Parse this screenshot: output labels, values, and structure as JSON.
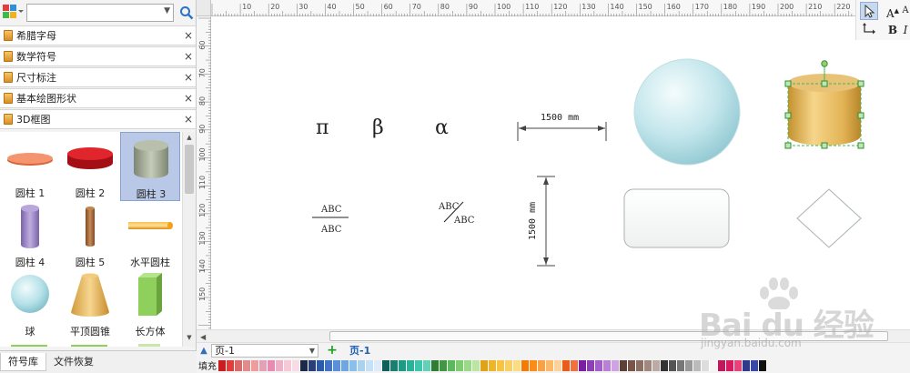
{
  "search": {
    "value": "",
    "placeholder": ""
  },
  "libraries": [
    {
      "label": "希腊字母",
      "close": "×"
    },
    {
      "label": "数学符号",
      "close": "×"
    },
    {
      "label": "尺寸标注",
      "close": "×"
    },
    {
      "label": "基本绘图形状",
      "close": "×"
    },
    {
      "label": "3D框图",
      "close": "×"
    }
  ],
  "shapes": [
    {
      "label": "圆柱 1",
      "icon": "flat-cylinder-icon",
      "color": "#f28a63"
    },
    {
      "label": "圆柱 2",
      "icon": "red-disc-cylinder-icon",
      "color": "#d2161e"
    },
    {
      "label": "圆柱 3",
      "icon": "gray-cylinder-icon",
      "color": "#9aa48f",
      "selected": true
    },
    {
      "label": "圆柱 4",
      "icon": "purple-cylinder-icon",
      "color": "#9b83c4"
    },
    {
      "label": "圆柱 5",
      "icon": "brown-cylinder-icon",
      "color": "#a86a3c"
    },
    {
      "label": "水平圆柱",
      "icon": "horizontal-cylinder-icon",
      "color": "#f2a21e"
    },
    {
      "label": "球",
      "icon": "sphere-icon",
      "color": "#a9dbe3"
    },
    {
      "label": "平顶圆锥",
      "icon": "frustum-icon",
      "color": "#efc26a"
    },
    {
      "label": "长方体",
      "icon": "cuboid-icon",
      "color": "#8fcf5b"
    }
  ],
  "bottom_tabs": [
    {
      "label": "符号库",
      "active": true
    },
    {
      "label": "文件恢复",
      "active": false
    }
  ],
  "ruler": {
    "top_labels": [
      "10",
      "20",
      "30",
      "40",
      "50",
      "60",
      "70",
      "80",
      "90",
      "100",
      "110",
      "120",
      "130",
      "140",
      "150",
      "160",
      "170",
      "180",
      "190",
      "200",
      "210",
      "220"
    ],
    "left_labels": [
      "60",
      "70",
      "80",
      "90",
      "100",
      "110",
      "120",
      "130",
      "140",
      "150"
    ]
  },
  "canvas": {
    "greek": [
      "π",
      "β",
      "α"
    ],
    "fraction_h": {
      "top": "ABC",
      "bottom": "ABC"
    },
    "fraction_diag": {
      "top": "ABC",
      "bottom": "ABC"
    },
    "dim_h": "1500 mm",
    "dim_v": "1500 mm"
  },
  "right_toolbar": {
    "pointer": "pointer-icon",
    "font_grow": "A",
    "font_shrink": "A",
    "connector": "connector-icon",
    "bold": "B",
    "italic": "I"
  },
  "page_bar": {
    "selected_page": "页-1",
    "add": "+",
    "tab": "页-1"
  },
  "fill_label": "填充",
  "palette": [
    "#c81e1e",
    "#e53b3b",
    "#d96a6a",
    "#e38a8a",
    "#ec9e9e",
    "#e4a0b6",
    "#e88bb2",
    "#f0b0c8",
    "#f6c9d6",
    "#f7dbe5",
    "#1b2a4a",
    "#27407a",
    "#2b5aa8",
    "#3f74c8",
    "#5a90d8",
    "#6da7e3",
    "#8abfe9",
    "#a9d2ef",
    "#c5e1f5",
    "#dcedf9",
    "#0f5f5a",
    "#168073",
    "#1c9a86",
    "#25b39a",
    "#3fc5a9",
    "#5fd3b7",
    "#2e7d32",
    "#3f9a3f",
    "#5cb85c",
    "#7ccd6b",
    "#9ad985",
    "#b9e6a1",
    "#e0a21a",
    "#f0b429",
    "#f6c343",
    "#f9d05f",
    "#fbdc85",
    "#f57c00",
    "#fb8c1c",
    "#fda040",
    "#fdb866",
    "#fdd19a",
    "#e85d1c",
    "#f17040",
    "#7b1fa2",
    "#8e3fb8",
    "#a45ec9",
    "#ba80d6",
    "#cfa3e2",
    "#5d4037",
    "#795548",
    "#8d6e63",
    "#a1887f",
    "#bcaaa4",
    "#333333",
    "#555555",
    "#777777",
    "#999999",
    "#bbbbbb",
    "#dddddd",
    "#f5f5f5",
    "#c2185b",
    "#d81b60",
    "#ec407a",
    "#2e3a8c",
    "#3949ab",
    "#111111"
  ],
  "watermark": {
    "brand": "Bai du 经验",
    "url": "jingyan.baidu.com"
  }
}
